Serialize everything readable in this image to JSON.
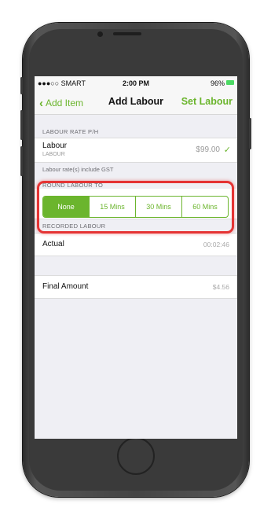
{
  "status_bar": {
    "carrier": "●●●○○ SMART",
    "time": "2:00 PM",
    "battery": "96%"
  },
  "navbar": {
    "back_label": "Add Item",
    "title": "Add Labour",
    "action_label": "Set Labour"
  },
  "labour_rate": {
    "header": "LABOUR RATE P/H",
    "label": "Labour",
    "sublabel": "LABOUR",
    "value": "$99.00",
    "footnote": "Labour rate(s) include GST"
  },
  "round_labour": {
    "header": "ROUND LABOUR TO",
    "options": [
      "None",
      "15 Mins",
      "30 Mins",
      "60 Mins"
    ],
    "selected": "None"
  },
  "recorded_labour": {
    "header": "RECORDED LABOUR",
    "label": "Actual",
    "value": "00:02:46"
  },
  "final": {
    "label": "Final Amount",
    "value": "$4.56"
  },
  "colors": {
    "accent": "#6bb52d",
    "highlight": "#e53434"
  }
}
